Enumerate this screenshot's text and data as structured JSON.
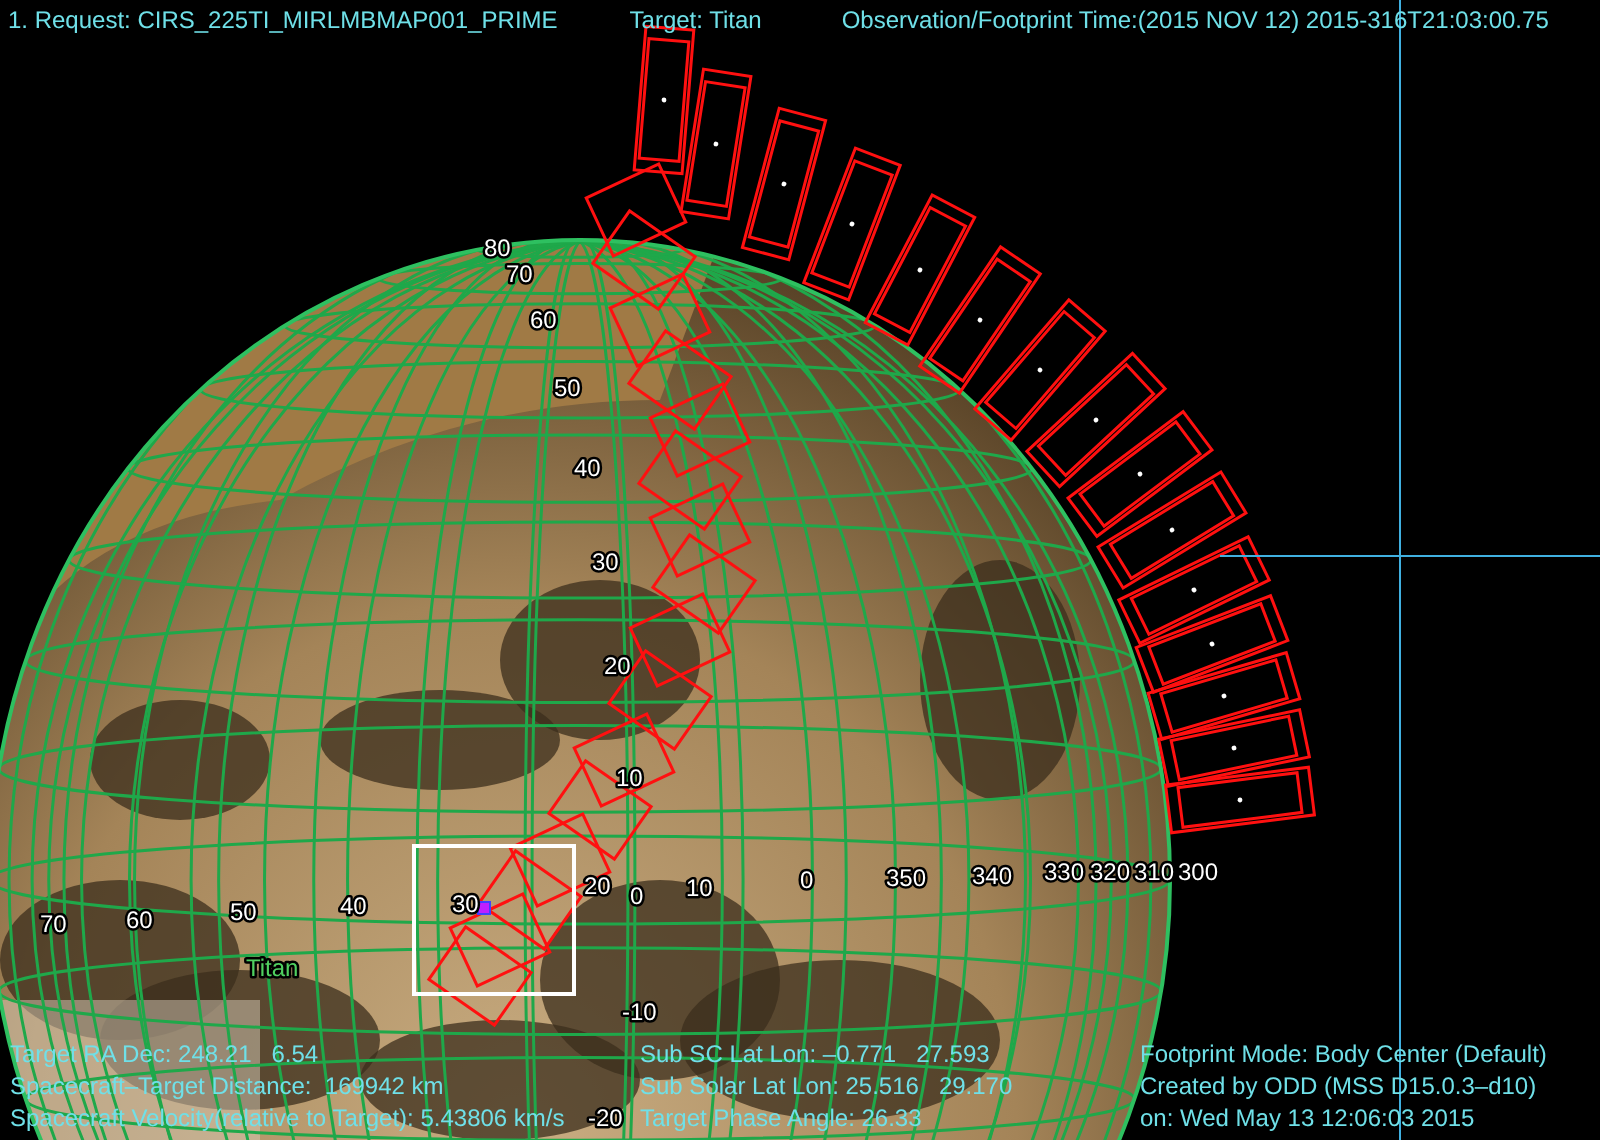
{
  "header": {
    "request": "1. Request: CIRS_225TI_MIRLMBMAP001_PRIME",
    "target": "Target: Titan",
    "time": "Observation/Footprint Time:(2015 NOV 12) 2015-316T21:03:00.75"
  },
  "map": {
    "body_label": "Titan",
    "latitude_labels": [
      "80",
      "70",
      "60",
      "50",
      "40",
      "30",
      "20",
      "10",
      "0",
      "-10",
      "-20"
    ],
    "longitude_labels": [
      "70",
      "60",
      "50",
      "40",
      "30",
      "20",
      "10",
      "0",
      "350",
      "340",
      "330",
      "320",
      "310",
      "300"
    ]
  },
  "footer": {
    "geometry": [
      "Target RA Dec: 248.21   6.54",
      "Spacecraft–Target Distance:  169942 km",
      "Spacecraft Velocity(relative to Target): 5.43806 km/s"
    ],
    "solar": [
      "Sub SC Lat Lon: –0.771   27.593",
      "Sub Solar Lat Lon: 25.516   29.170",
      "Target Phase Angle: 26.33"
    ],
    "info": [
      "Footprint Mode: Body Center (Default)",
      "Created by ODD (MSS D15.0.3–d10)",
      "on: Wed May 13 12:06:03 2015"
    ]
  }
}
